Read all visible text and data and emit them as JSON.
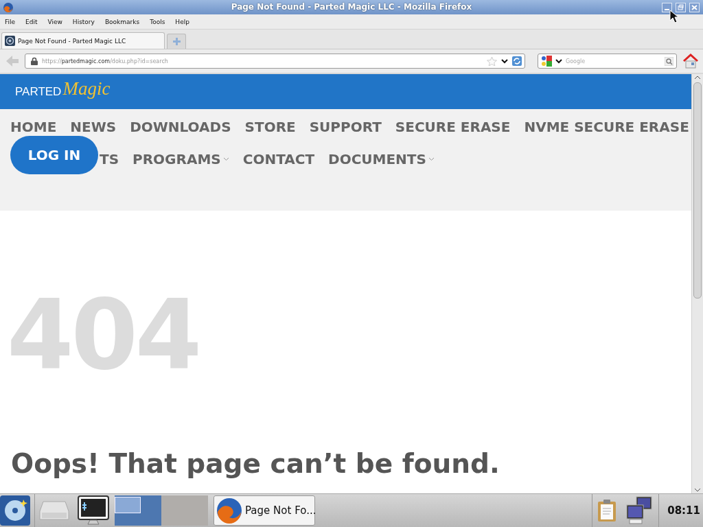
{
  "window": {
    "title": "Page Not Found - Parted Magic LLC - Mozilla Firefox"
  },
  "menu": [
    "File",
    "Edit",
    "View",
    "History",
    "Bookmarks",
    "Tools",
    "Help"
  ],
  "tabs": [
    {
      "label": "Page Not Found - Parted Magic LLC",
      "selected": true
    }
  ],
  "address_bar": {
    "scheme": "https://",
    "host": "partedmagic.com",
    "path": "/doku.php?id=search"
  },
  "search": {
    "placeholder": "Google"
  },
  "site": {
    "logo": {
      "word": "PARTED",
      "script": "Magic"
    },
    "nav_rows": [
      [
        {
          "label": "HOME",
          "dropdown": false
        },
        {
          "label": "NEWS",
          "dropdown": false
        },
        {
          "label": "DOWNLOADS",
          "dropdown": false
        },
        {
          "label": "STORE",
          "dropdown": false
        },
        {
          "label": "SUPPORT",
          "dropdown": false
        },
        {
          "label": "SECURE ERASE",
          "dropdown": false
        },
        {
          "label": "NVME SECURE ERASE",
          "dropdown": false
        }
      ],
      [
        {
          "label": "TS",
          "dropdown": false
        },
        {
          "label": "PROGRAMS",
          "dropdown": true
        },
        {
          "label": "CONTACT",
          "dropdown": false
        },
        {
          "label": "DOCUMENTS",
          "dropdown": true
        }
      ]
    ],
    "login": "LOG IN"
  },
  "error": {
    "code": "404",
    "message": "Oops! That page can’t be found."
  },
  "taskbar": {
    "workspaces": [
      {
        "selected": true
      },
      {
        "selected": false
      }
    ],
    "tasks": [
      {
        "label": "Page Not Fo...",
        "selected": true
      }
    ],
    "clock": "08:11"
  }
}
